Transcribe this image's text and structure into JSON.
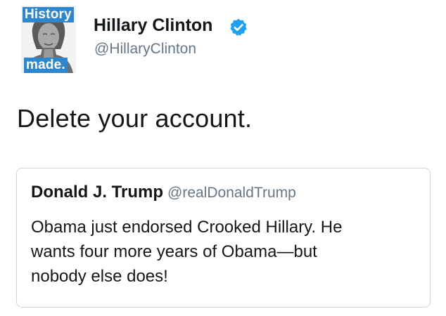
{
  "tweet": {
    "author": {
      "display_name": "Hillary Clinton",
      "handle": "@HillaryClinton",
      "verified": true,
      "avatar_badge_top": "History",
      "avatar_badge_bottom": "made.",
      "badge_color": "#2a87d0",
      "verified_color": "#1da1f2"
    },
    "text": "Delete your account.",
    "quoted_tweet": {
      "display_name": "Donald J. Trump",
      "handle": "@realDonaldTrump",
      "text": "Obama just endorsed Crooked Hillary. He\nwants four more years of Obama—but\nnobody else does!"
    }
  },
  "colors": {
    "primary_text": "#14171a",
    "secondary_text": "#657786",
    "card_border": "#cfd6dc"
  }
}
